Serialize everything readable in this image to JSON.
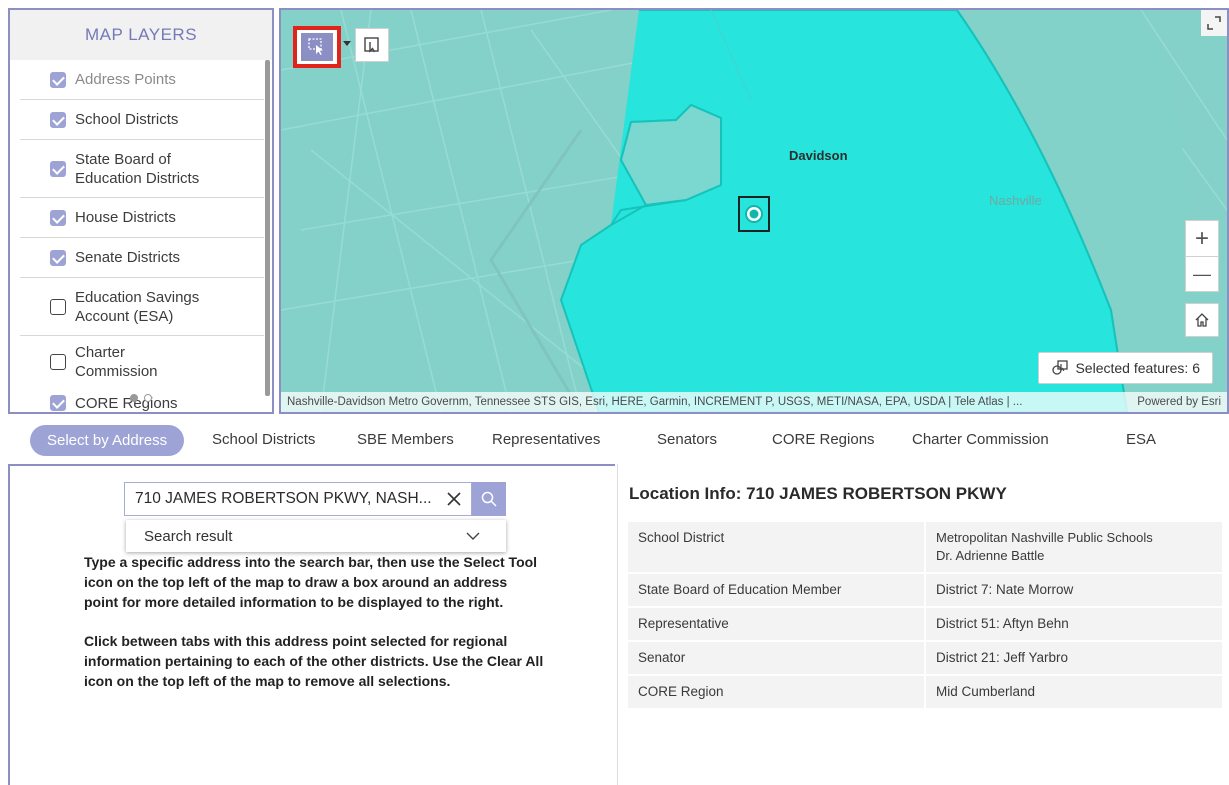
{
  "layers": {
    "title": "MAP LAYERS",
    "items": [
      {
        "label": "Address Points",
        "checked": true
      },
      {
        "label": "School Districts",
        "checked": true
      },
      {
        "label": "State Board of Education Districts",
        "checked": true
      },
      {
        "label": "House Districts",
        "checked": true
      },
      {
        "label": "Senate Districts",
        "checked": true
      },
      {
        "label": "Education Savings Account (ESA)",
        "checked": false
      },
      {
        "label": "Charter Commission",
        "checked": false
      },
      {
        "label": "CORE Regions",
        "checked": true
      }
    ]
  },
  "map": {
    "place_label": "Davidson",
    "city_label": "Nashville",
    "selected_features": "Selected features: 6",
    "attribution": "Nashville-Davidson Metro Governm, Tennessee STS GIS, Esri, HERE, Garmin, INCREMENT P, USGS, METI/NASA, EPA, USDA | Tele Atlas | ...",
    "powered_by": "Powered by Esri",
    "zoom_in": "+",
    "zoom_out": "—",
    "colors": {
      "highlight": "#28e6dc",
      "accent": "#8b8fc4",
      "tool_outline": "#e0231b"
    }
  },
  "tabs": [
    {
      "label": "Select by Address",
      "active": true
    },
    {
      "label": "School Districts"
    },
    {
      "label": "SBE Members"
    },
    {
      "label": "Representatives"
    },
    {
      "label": "Senators"
    },
    {
      "label": "CORE Regions"
    },
    {
      "label": "Charter Commission"
    },
    {
      "label": "ESA"
    }
  ],
  "search": {
    "value": "710 JAMES ROBERTSON PKWY, NASH...",
    "result_label": "Search result"
  },
  "instructions": {
    "p1": "Type a specific address into the search bar, then use the Select Tool icon on the top left of the map to draw a box around an address point for more detailed information to be displayed to the right.",
    "p2": "Click between tabs with this address point selected for regional information pertaining to each of the other districts. Use the Clear All icon on the top left of the map to remove all selections."
  },
  "location_info": {
    "title": "Location Info: 710 JAMES ROBERTSON PKWY",
    "rows": [
      {
        "label": "School District",
        "value": "Metropolitan Nashville Public Schools",
        "sub": "Dr. Adrienne Battle"
      },
      {
        "label": "State Board of Education Member",
        "value": "District 7: Nate Morrow"
      },
      {
        "label": "Representative",
        "value": "District 51: Aftyn Behn"
      },
      {
        "label": "Senator",
        "value": "District 21: Jeff Yarbro"
      },
      {
        "label": "CORE Region",
        "value": "Mid Cumberland"
      }
    ]
  }
}
